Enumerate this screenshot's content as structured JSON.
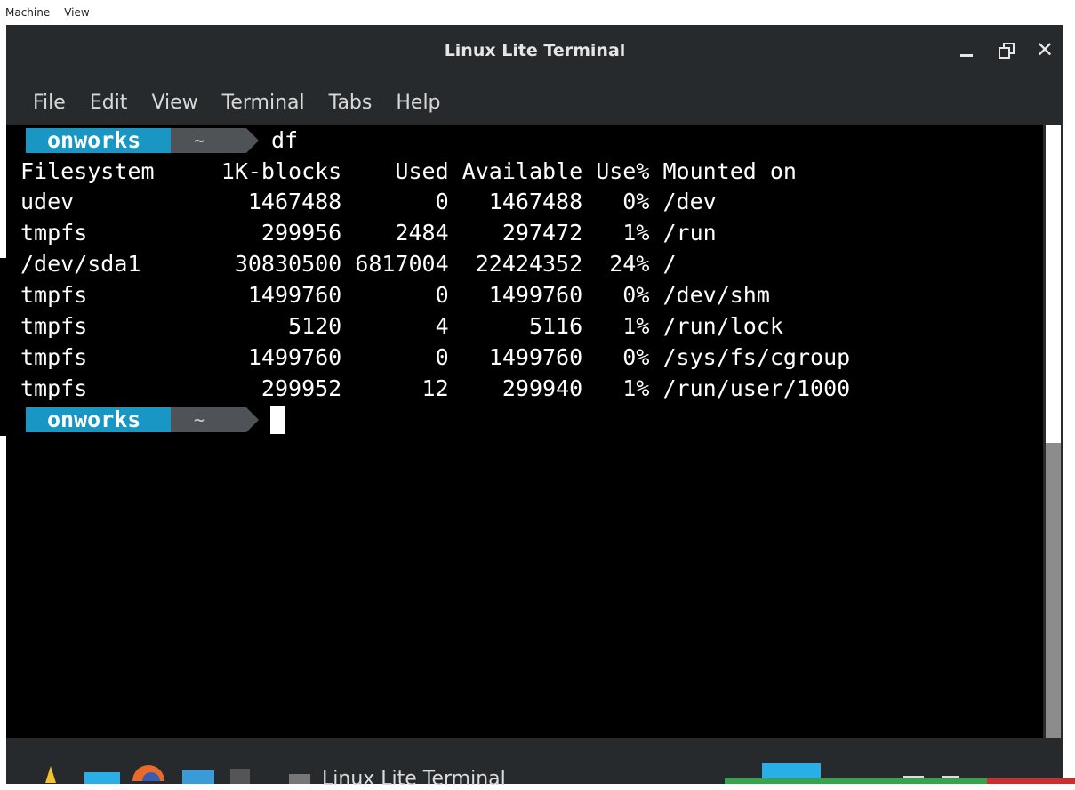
{
  "host_menu": {
    "items": [
      "Machine",
      "View"
    ]
  },
  "window": {
    "title": "Linux Lite Terminal"
  },
  "menubar": {
    "items": [
      "File",
      "Edit",
      "View",
      "Terminal",
      "Tabs",
      "Help"
    ]
  },
  "prompt": {
    "user": "onworks",
    "dir": "~"
  },
  "command": "df",
  "output": {
    "header": "Filesystem     1K-blocks    Used Available Use% Mounted on",
    "rows": [
      "udev             1467488       0   1467488   0% /dev",
      "tmpfs             299956    2484    297472   1% /run",
      "/dev/sda1       30830500 6817004  22424352  24% /",
      "tmpfs            1499760       0   1499760   0% /dev/shm",
      "tmpfs               5120       4      5116   1% /run/lock",
      "tmpfs            1499760       0   1499760   0% /sys/fs/cgroup",
      "tmpfs             299952      12    299940   1% /run/user/1000"
    ]
  },
  "taskbar": {
    "window_label": "Linux Lite Terminal"
  },
  "colors": {
    "prompt_user": "#1a96c5",
    "prompt_dir": "#4f5257",
    "terminal_bg": "#000000"
  }
}
